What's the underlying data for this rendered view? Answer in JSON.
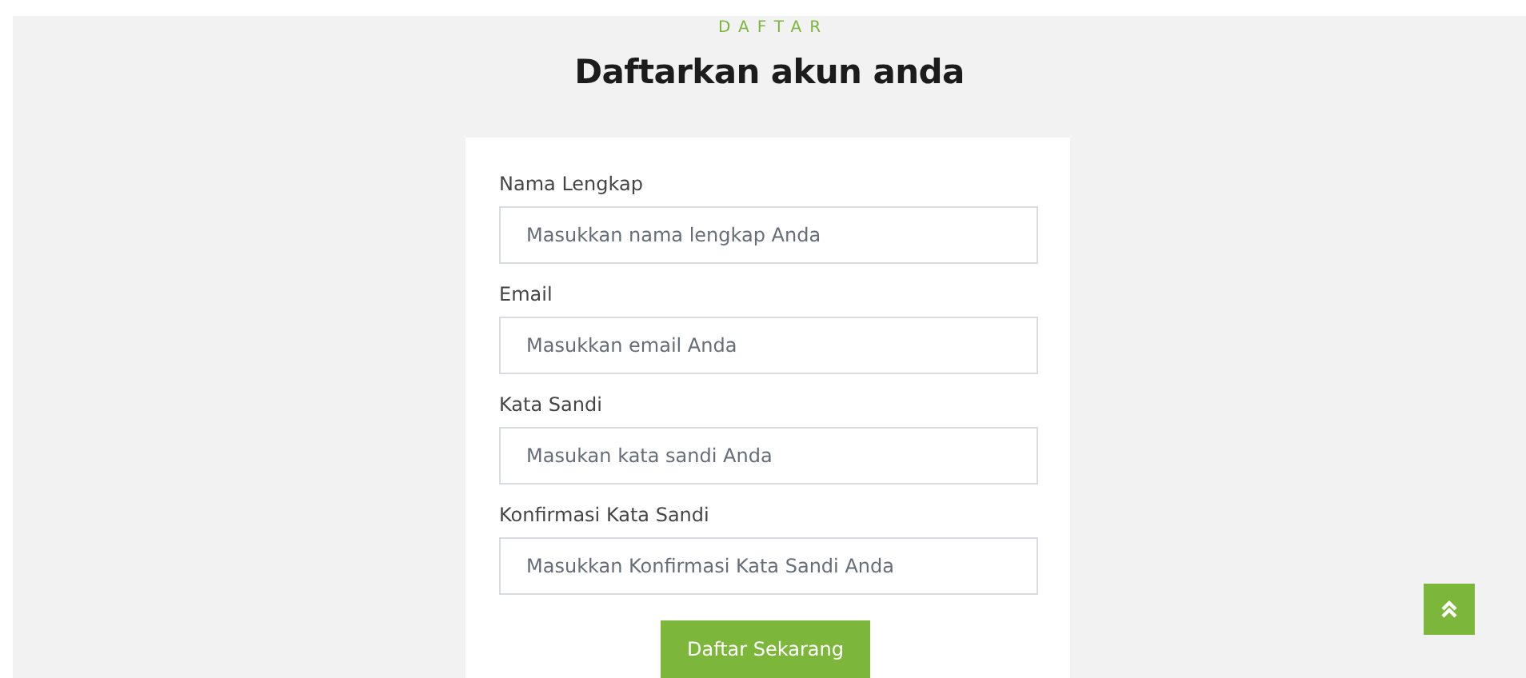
{
  "section": {
    "eyebrow": "DAFTAR",
    "title": "Daftarkan akun anda"
  },
  "form": {
    "fields": [
      {
        "label": "Nama Lengkap",
        "placeholder": "Masukkan nama lengkap Anda"
      },
      {
        "label": "Email",
        "placeholder": "Masukkan email Anda"
      },
      {
        "label": "Kata Sandi",
        "placeholder": "Masukan kata sandi Anda"
      },
      {
        "label": "Konfirmasi Kata Sandi",
        "placeholder": "Masukkan Konfirmasi Kata Sandi Anda"
      }
    ],
    "submit": "Daftar Sekarang"
  }
}
